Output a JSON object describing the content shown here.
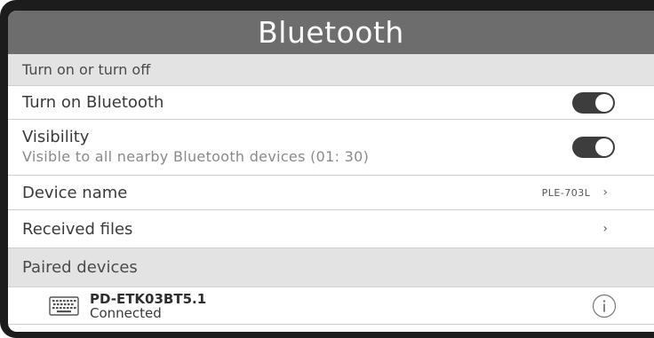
{
  "header": {
    "title": "Bluetooth"
  },
  "sections": {
    "toggle_section": "Turn on or turn off",
    "paired_section": "Paired devices"
  },
  "settings": {
    "turn_on_label": "Turn on Bluetooth",
    "turn_on_state": "on",
    "visibility_label": "Visibility",
    "visibility_desc": "Visible to all nearby Bluetooth devices  (01:  30)",
    "visibility_state": "on",
    "device_name_label": "Device  name",
    "device_name_value": "PLE-703L",
    "received_files_label": "Received files"
  },
  "paired_devices": [
    {
      "name": "PD-ETK03BT5.1",
      "status": "Connected",
      "icon": "keyboard-icon"
    }
  ],
  "icons": {
    "chevron": "›",
    "info": "info-icon"
  },
  "colors": {
    "header_bg": "#6d6d6d",
    "section_bg": "#e3e3e3",
    "toggle_on": "#3d3d3d"
  }
}
